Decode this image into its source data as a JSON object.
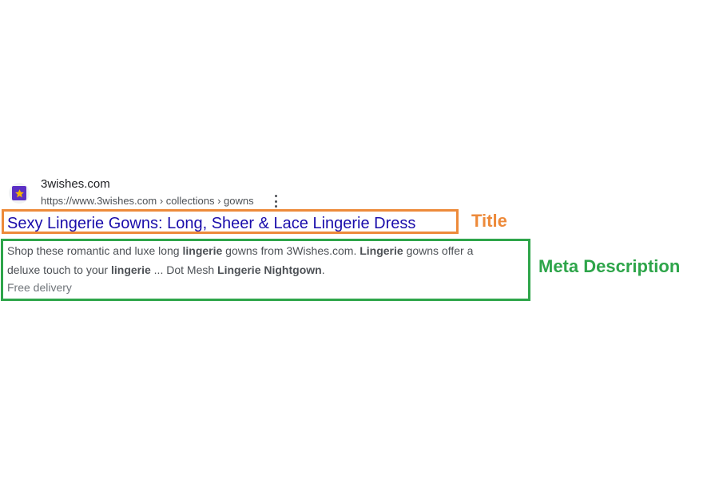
{
  "result": {
    "site_name": "3wishes.com",
    "url": "https://www.3wishes.com › collections › gowns",
    "title": "Sexy Lingerie Gowns: Long, Sheer & Lace Lingerie Dress",
    "snippet": {
      "line1": {
        "t1": "Shop these romantic and luxe long ",
        "b1": "lingerie",
        "t2": " gowns from 3Wishes.com. ",
        "b2": "Lingerie",
        "t3": " gowns offer a"
      },
      "line2": {
        "t1": "deluxe touch to your ",
        "b1": "lingerie",
        "t2": " ... Dot Mesh ",
        "b2": "Lingerie Nightgown",
        "t3": "."
      }
    },
    "extra": "Free delivery"
  },
  "annotations": {
    "title_label": "Title",
    "meta_label": "Meta Description"
  },
  "icons": {
    "favicon": "star-icon",
    "menu": "more-vert-icon"
  },
  "colors": {
    "title_link": "#1a0dab",
    "title_box": "#ed8a3a",
    "meta_box": "#2ea54a",
    "favicon_bg": "#5b2fc4",
    "favicon_star": "#f4b400"
  }
}
